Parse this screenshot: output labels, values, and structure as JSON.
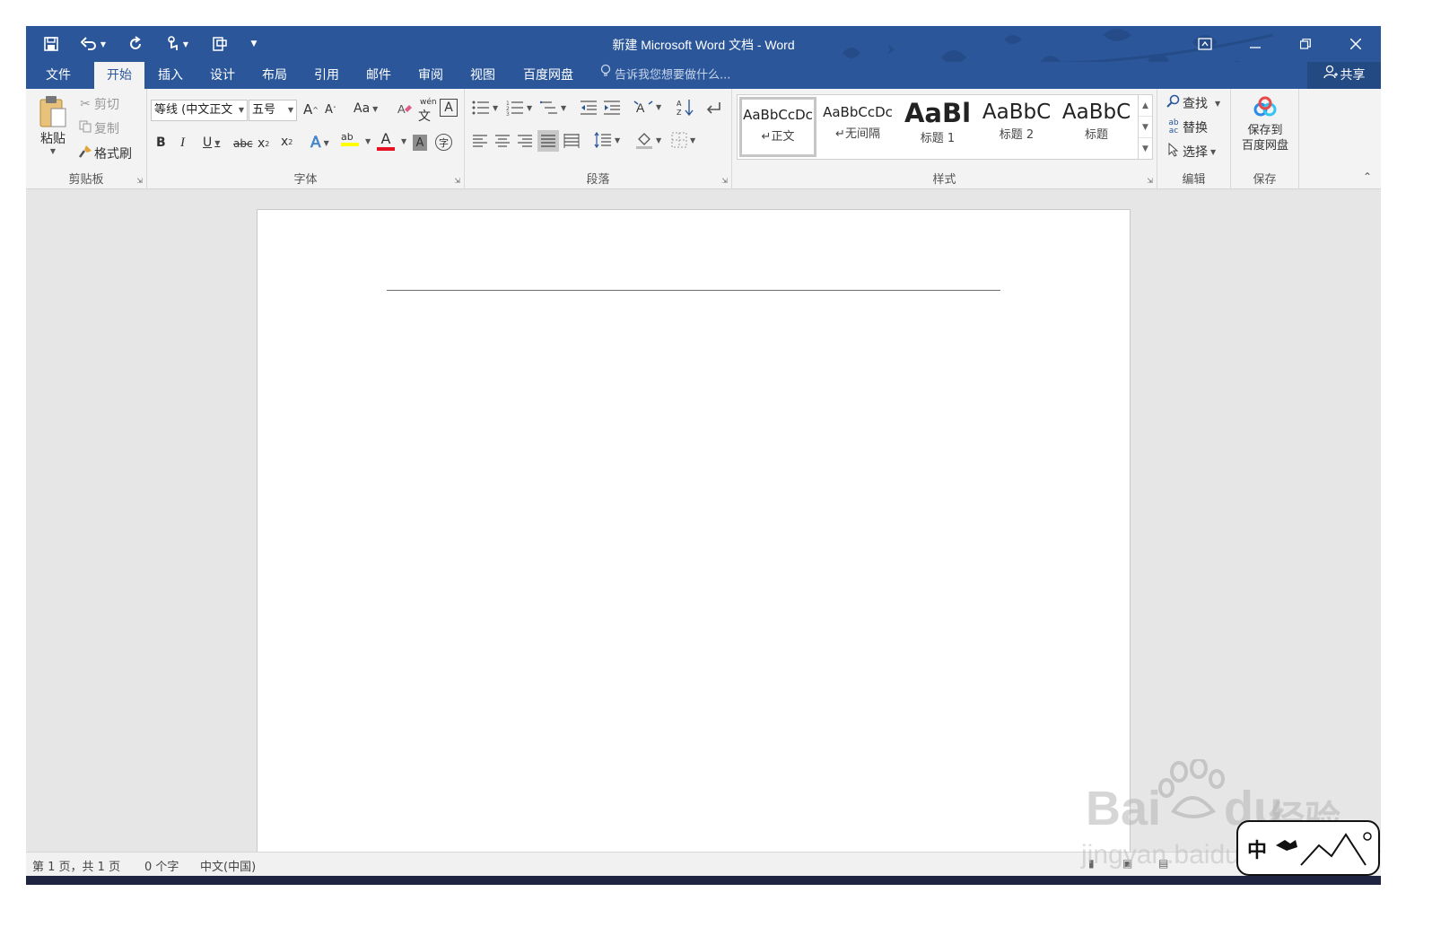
{
  "window": {
    "title": "新建 Microsoft Word 文档 - Word",
    "accent": "#2b579a"
  },
  "qat": {
    "icons": [
      "save-icon",
      "undo-icon",
      "redo-icon",
      "touch-mode-icon",
      "print-preview-icon",
      "customize-qat-icon"
    ]
  },
  "tabs": [
    "文件",
    "开始",
    "插入",
    "设计",
    "布局",
    "引用",
    "邮件",
    "审阅",
    "视图",
    "百度网盘"
  ],
  "active_tab": "开始",
  "tell_me": "告诉我您想要做什么...",
  "share": "共享",
  "ribbon": {
    "clipboard": {
      "label": "剪贴板",
      "paste": "粘贴",
      "cut": "剪切",
      "copy": "复制",
      "format_painter": "格式刷"
    },
    "font": {
      "label": "字体",
      "font_name": "等线 (中文正文",
      "font_size": "五号",
      "change_case": "Aa",
      "bold": "B",
      "italic": "I",
      "underline": "U",
      "strike": "abc",
      "font_color_hex": "#e81123",
      "highlight_hex": "#ffff00"
    },
    "paragraph": {
      "label": "段落"
    },
    "styles": {
      "label": "样式",
      "items": [
        {
          "sample": "AaBbCcDc",
          "name": "正文"
        },
        {
          "sample": "AaBbCcDc",
          "name": "无间隔"
        },
        {
          "sample": "AaBl",
          "name": "标题 1"
        },
        {
          "sample": "AaBbC",
          "name": "标题 2"
        },
        {
          "sample": "AaBbC",
          "name": "标题"
        }
      ]
    },
    "editing": {
      "label": "编辑",
      "find": "查找",
      "replace": "替换",
      "select": "选择"
    },
    "save": {
      "label": "保存",
      "button_line1": "保存到",
      "button_line2": "百度网盘"
    }
  },
  "status": {
    "page": "第 1 页，共 1 页",
    "words": "0 个字",
    "language": "中文(中国)"
  },
  "watermark": {
    "brand": "Bai",
    "brand2": "du",
    "cn": "经验",
    "url": "jingyan.baidu.com",
    "badge": "中"
  }
}
